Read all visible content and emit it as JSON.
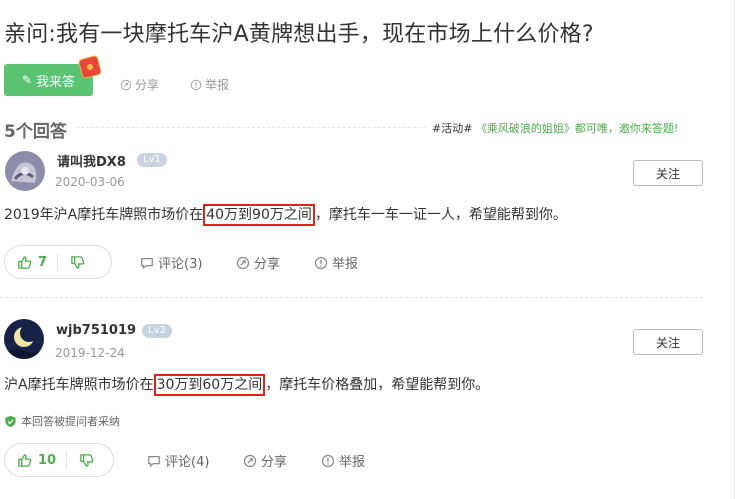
{
  "question": {
    "title": "亲问:我有一块摩托车沪A黄牌想出手，现在市场上什么价格?",
    "answer_button": "我来答",
    "share": "分享",
    "report": "举报"
  },
  "answers_header": {
    "count_label": "5个回答",
    "activity_prefix": "#活动#",
    "activity_link": "《乘风破浪的姐姐》都可唯，邀你来答题!"
  },
  "answers": [
    {
      "username": "请叫我DX8",
      "level": "Lv1",
      "date": "2020-03-06",
      "follow": "关注",
      "text_before": "2019年沪A摩托车牌照市场价在",
      "text_highlight": "40万到90万之间",
      "text_after": "，摩托车一车一证一人，希望能帮到你。",
      "likes": "7",
      "comments": "评论(3)",
      "share": "分享",
      "report": "举报"
    },
    {
      "username": "wjb751019",
      "level": "Lv2",
      "date": "2019-12-24",
      "follow": "关注",
      "text_before": "沪A摩托车牌照市场价在",
      "text_highlight": "30万到60万之间",
      "text_after": "，摩托车价格叠加，希望能帮到你。",
      "accepted": "本回答被提问者采纳",
      "likes": "10",
      "comments": "评论(4)",
      "share": "分享",
      "report": "举报"
    }
  ],
  "colors": {
    "accent_green": "#5ac472",
    "highlight_red": "#e0241a",
    "muted": "#999999"
  }
}
